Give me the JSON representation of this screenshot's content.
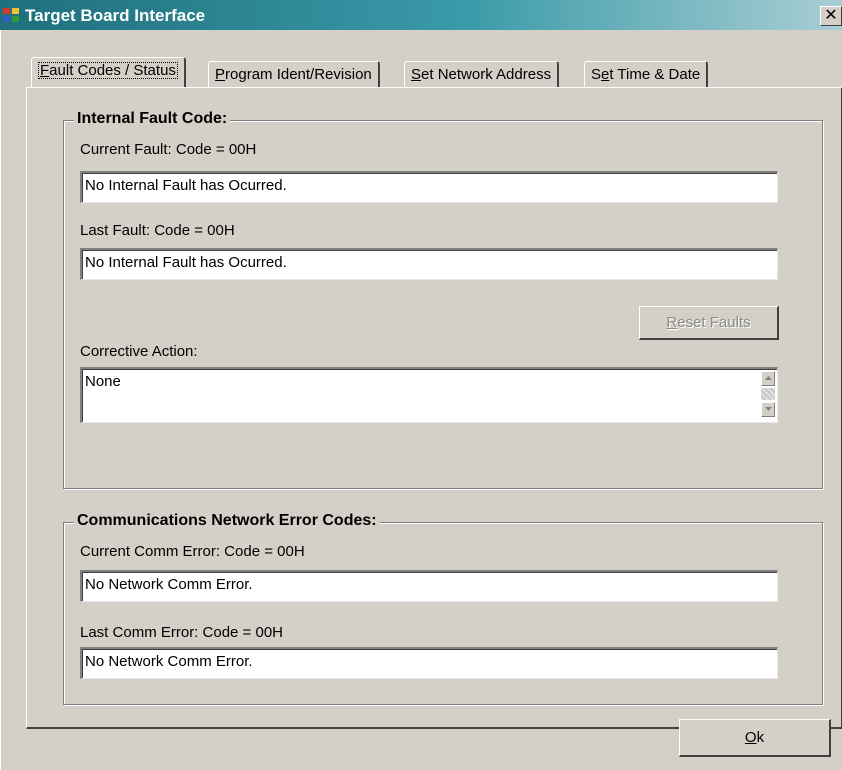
{
  "window": {
    "title": "Target Board Interface",
    "close_label": "✕"
  },
  "tabs": [
    {
      "first": "F",
      "rest": "ault Codes / Status"
    },
    {
      "first": "P",
      "rest": "rogram Ident/Revision"
    },
    {
      "first": "S",
      "rest": "et Network Address"
    },
    {
      "first": "S",
      "mid": "e",
      "rest": "t Time & Date"
    }
  ],
  "internal": {
    "title": "Internal Fault Code:",
    "current_label": "Current Fault: Code = 00H",
    "current_value": "No Internal Fault has Ocurred.",
    "last_label": "Last Fault: Code = 00H",
    "last_value": "No Internal Fault has Ocurred.",
    "reset_first": "R",
    "reset_rest": "eset Faults",
    "corrective_label": "Corrective Action:",
    "corrective_value": "None"
  },
  "network": {
    "title": "Communications Network Error Codes:",
    "current_label": "Current Comm Error: Code = 00H",
    "current_value": "No Network Comm Error.",
    "last_label": "Last Comm Error: Code = 00H",
    "last_value": "No Network Comm Error."
  },
  "ok_button": {
    "first": "O",
    "rest": "k"
  }
}
